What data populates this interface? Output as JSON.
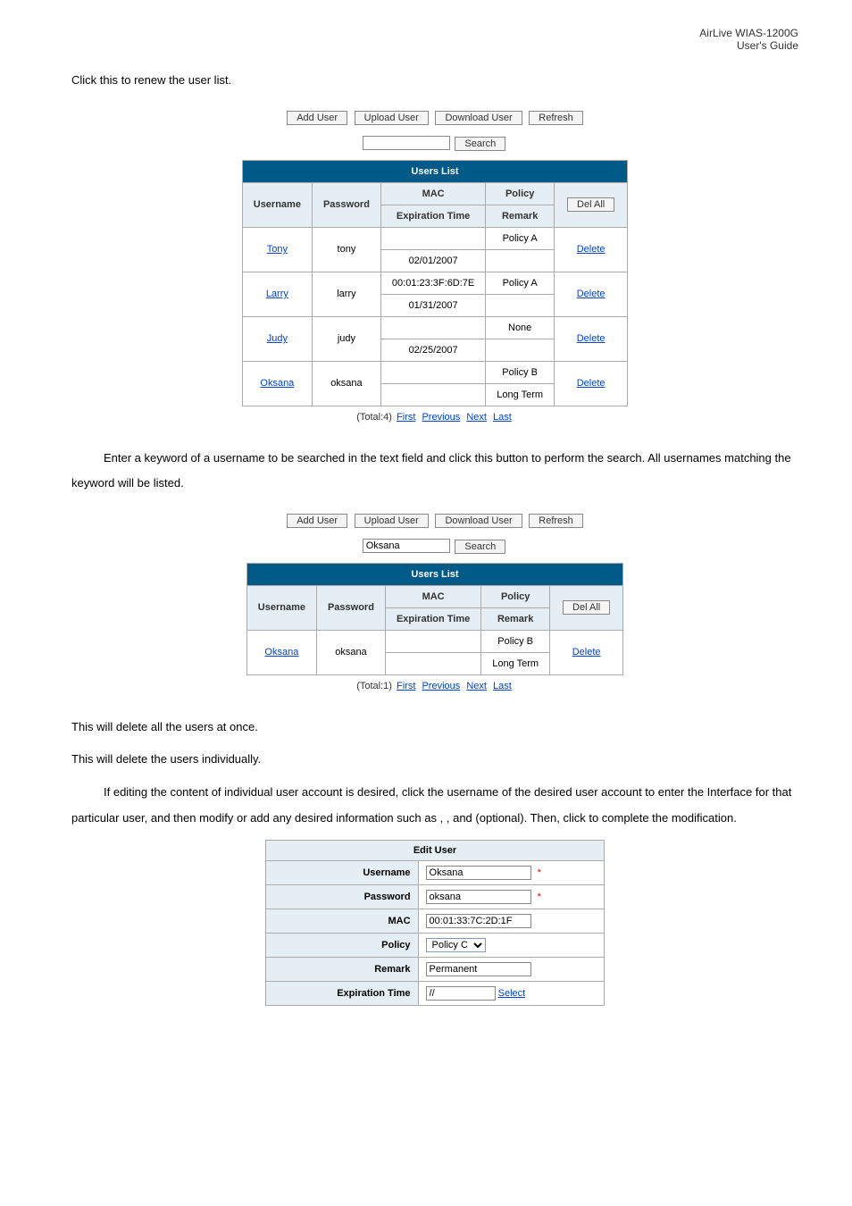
{
  "header": {
    "product": "AirLive  WIAS-1200G",
    "doc": "User's  Guide"
  },
  "intro1": "Click this to renew the user list.",
  "toolbar": {
    "add": "Add User",
    "upload": "Upload User",
    "download": "Download User",
    "refresh": "Refresh",
    "search": "Search"
  },
  "search1_value": "",
  "users_list_title": "Users List",
  "cols": {
    "username": "Username",
    "password": "Password",
    "mac": "MAC",
    "policy": "Policy",
    "exp": "Expiration Time",
    "remark": "Remark",
    "delall": "Del All",
    "delete": "Delete"
  },
  "rows1": [
    {
      "user": "Tony",
      "pw": "tony",
      "mac": "",
      "pol": "Policy A",
      "exp": "02/01/2007",
      "rem": ""
    },
    {
      "user": "Larry",
      "pw": "larry",
      "mac": "00:01:23:3F:6D:7E",
      "pol": "Policy A",
      "exp": "01/31/2007",
      "rem": ""
    },
    {
      "user": "Judy",
      "pw": "judy",
      "mac": "",
      "pol": "None",
      "exp": "02/25/2007",
      "rem": ""
    },
    {
      "user": "Oksana",
      "pw": "oksana",
      "mac": "",
      "pol": "Policy B",
      "exp": "",
      "rem": "Long Term"
    }
  ],
  "pager1": {
    "total": "(Total:4)",
    "first": "First",
    "prev": "Previous",
    "next": "Next",
    "last": "Last"
  },
  "intro2": "Enter a keyword of a username to be searched in the text field and click this button to perform the search. All usernames matching the keyword will be listed.",
  "search2_value": "Oksana",
  "rows2": [
    {
      "user": "Oksana",
      "pw": "oksana",
      "mac": "",
      "pol": "Policy B",
      "exp": "",
      "rem": "Long Term"
    }
  ],
  "pager2": {
    "total": "(Total:1)",
    "first": "First",
    "prev": "Previous",
    "next": "Next",
    "last": "Last"
  },
  "note1": "This will delete all the users at once.",
  "note2": "This will delete the users individually.",
  "para3a": "If editing the content of individual user account is desired, click the username of the desired user account to enter the ",
  "para3b": " Interface for that particular user, and then modify or add any desired information such as ",
  "comma": ", ",
  "and": " and ",
  "para3c": " (optional). Then, click ",
  "para3d": " to complete the modification.",
  "edit": {
    "title": "Edit User",
    "labels": {
      "username": "Username",
      "password": "Password",
      "mac": "MAC",
      "policy": "Policy",
      "remark": "Remark",
      "exp": "Expiration Time"
    },
    "values": {
      "username": "Oksana",
      "password": "oksana",
      "mac": "00:01:33:7C:2D:1F",
      "policy": "Policy C",
      "remark": "Permanent",
      "exp": "//"
    },
    "select_link": "Select"
  }
}
